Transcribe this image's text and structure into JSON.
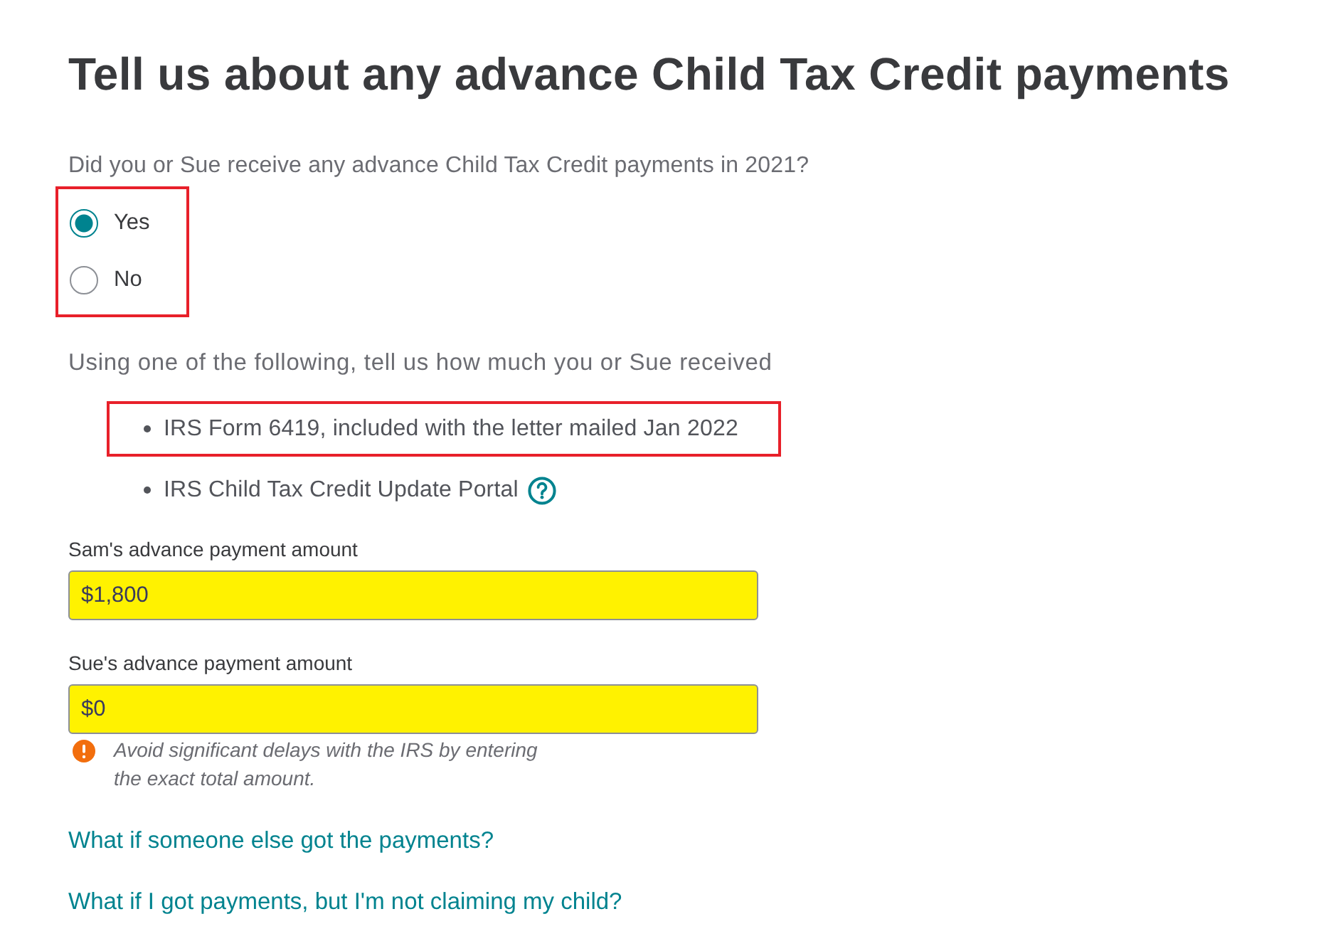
{
  "page": {
    "title": "Tell us about any advance Child Tax Credit payments"
  },
  "question": {
    "text": "Did you or Sue receive any advance Child Tax Credit payments in 2021?",
    "outlined": true,
    "options": [
      {
        "label": "Yes",
        "selected": true
      },
      {
        "label": "No",
        "selected": false
      }
    ]
  },
  "sources": {
    "intro": "Using one of the following, tell us how much you or Sue received",
    "items": [
      {
        "text": "IRS Form 6419, included with the letter mailed Jan 2022",
        "outlined": true,
        "help": false
      },
      {
        "text": "IRS Child Tax Credit Update Portal",
        "outlined": false,
        "help": true
      }
    ]
  },
  "fields": [
    {
      "label": "Sam's advance payment amount",
      "value": "$1,800",
      "highlighted": true
    },
    {
      "label": "Sue's advance payment amount",
      "value": "$0",
      "highlighted": true,
      "warning": "Avoid significant delays with the IRS by entering the exact total amount."
    }
  ],
  "links": [
    "What if someone else got the payments?",
    "What if I got payments, but I'm not claiming my child?"
  ]
}
